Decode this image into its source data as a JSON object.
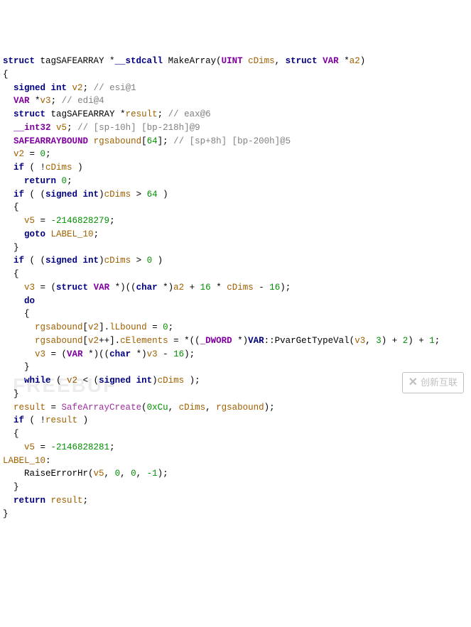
{
  "lines": [
    {
      "segments": [
        {
          "c": "ctype",
          "t": "struct"
        },
        {
          "c": "op",
          "t": " tagSAFEARRAY *"
        },
        {
          "c": "ctype",
          "t": "__stdcall"
        },
        {
          "c": "op",
          "t": " MakeArray("
        },
        {
          "c": "purple",
          "t": "UINT"
        },
        {
          "c": "op",
          "t": " "
        },
        {
          "c": "local",
          "t": "cDims"
        },
        {
          "c": "op",
          "t": ", "
        },
        {
          "c": "ctype",
          "t": "struct"
        },
        {
          "c": "op",
          "t": " "
        },
        {
          "c": "purple",
          "t": "VAR"
        },
        {
          "c": "op",
          "t": " *"
        },
        {
          "c": "local",
          "t": "a2"
        },
        {
          "c": "op",
          "t": ")"
        }
      ]
    },
    {
      "segments": [
        {
          "c": "op",
          "t": "{"
        }
      ]
    },
    {
      "segments": [
        {
          "c": "op",
          "t": "  "
        },
        {
          "c": "ctype",
          "t": "signed int"
        },
        {
          "c": "op",
          "t": " "
        },
        {
          "c": "local",
          "t": "v2"
        },
        {
          "c": "op",
          "t": "; "
        },
        {
          "c": "cmnt",
          "t": "// esi@1"
        }
      ]
    },
    {
      "segments": [
        {
          "c": "op",
          "t": "  "
        },
        {
          "c": "purple",
          "t": "VAR"
        },
        {
          "c": "op",
          "t": " *"
        },
        {
          "c": "local",
          "t": "v3"
        },
        {
          "c": "op",
          "t": "; "
        },
        {
          "c": "cmnt",
          "t": "// edi@4"
        }
      ]
    },
    {
      "segments": [
        {
          "c": "op",
          "t": "  "
        },
        {
          "c": "ctype",
          "t": "struct"
        },
        {
          "c": "op",
          "t": " tagSAFEARRAY *"
        },
        {
          "c": "local",
          "t": "result"
        },
        {
          "c": "op",
          "t": "; "
        },
        {
          "c": "cmnt",
          "t": "// eax@6"
        }
      ]
    },
    {
      "segments": [
        {
          "c": "op",
          "t": "  "
        },
        {
          "c": "purple",
          "t": "__int32"
        },
        {
          "c": "op",
          "t": " "
        },
        {
          "c": "local",
          "t": "v5"
        },
        {
          "c": "op",
          "t": "; "
        },
        {
          "c": "cmnt",
          "t": "// [sp-10h] [bp-218h]@9"
        }
      ]
    },
    {
      "segments": [
        {
          "c": "op",
          "t": "  "
        },
        {
          "c": "purple",
          "t": "SAFEARRAYBOUND"
        },
        {
          "c": "op",
          "t": " "
        },
        {
          "c": "local",
          "t": "rgsabound"
        },
        {
          "c": "op",
          "t": "["
        },
        {
          "c": "num",
          "t": "64"
        },
        {
          "c": "op",
          "t": "]; "
        },
        {
          "c": "cmnt",
          "t": "// [sp+8h] [bp-200h]@5"
        }
      ]
    },
    {
      "segments": [
        {
          "c": "op",
          "t": ""
        }
      ]
    },
    {
      "segments": [
        {
          "c": "op",
          "t": "  "
        },
        {
          "c": "local",
          "t": "v2"
        },
        {
          "c": "op",
          "t": " = "
        },
        {
          "c": "num",
          "t": "0"
        },
        {
          "c": "op",
          "t": ";"
        }
      ]
    },
    {
      "segments": [
        {
          "c": "op",
          "t": "  "
        },
        {
          "c": "ctype",
          "t": "if"
        },
        {
          "c": "op",
          "t": " ( !"
        },
        {
          "c": "local",
          "t": "cDims"
        },
        {
          "c": "op",
          "t": " )"
        }
      ]
    },
    {
      "segments": [
        {
          "c": "op",
          "t": "    "
        },
        {
          "c": "ctype",
          "t": "return"
        },
        {
          "c": "op",
          "t": " "
        },
        {
          "c": "num",
          "t": "0"
        },
        {
          "c": "op",
          "t": ";"
        }
      ]
    },
    {
      "segments": [
        {
          "c": "op",
          "t": "  "
        },
        {
          "c": "ctype",
          "t": "if"
        },
        {
          "c": "op",
          "t": " ( ("
        },
        {
          "c": "ctype",
          "t": "signed int"
        },
        {
          "c": "op",
          "t": ")"
        },
        {
          "c": "local",
          "t": "cDims"
        },
        {
          "c": "op",
          "t": " > "
        },
        {
          "c": "num",
          "t": "64"
        },
        {
          "c": "op",
          "t": " )"
        }
      ]
    },
    {
      "segments": [
        {
          "c": "op",
          "t": "  {"
        }
      ]
    },
    {
      "segments": [
        {
          "c": "op",
          "t": "    "
        },
        {
          "c": "local",
          "t": "v5"
        },
        {
          "c": "op",
          "t": " = "
        },
        {
          "c": "num",
          "t": "-2146828279"
        },
        {
          "c": "op",
          "t": ";"
        }
      ]
    },
    {
      "segments": [
        {
          "c": "op",
          "t": "    "
        },
        {
          "c": "ctype",
          "t": "goto"
        },
        {
          "c": "op",
          "t": " "
        },
        {
          "c": "local",
          "t": "LABEL_10"
        },
        {
          "c": "op",
          "t": ";"
        }
      ]
    },
    {
      "segments": [
        {
          "c": "op",
          "t": "  }"
        }
      ]
    },
    {
      "segments": [
        {
          "c": "op",
          "t": "  "
        },
        {
          "c": "ctype",
          "t": "if"
        },
        {
          "c": "op",
          "t": " ( ("
        },
        {
          "c": "ctype",
          "t": "signed int"
        },
        {
          "c": "op",
          "t": ")"
        },
        {
          "c": "local",
          "t": "cDims"
        },
        {
          "c": "op",
          "t": " > "
        },
        {
          "c": "num",
          "t": "0"
        },
        {
          "c": "op",
          "t": " )"
        }
      ]
    },
    {
      "segments": [
        {
          "c": "op",
          "t": "  {"
        }
      ]
    },
    {
      "segments": [
        {
          "c": "op",
          "t": "    "
        },
        {
          "c": "local",
          "t": "v3"
        },
        {
          "c": "op",
          "t": " = ("
        },
        {
          "c": "ctype",
          "t": "struct"
        },
        {
          "c": "op",
          "t": " "
        },
        {
          "c": "purple",
          "t": "VAR"
        },
        {
          "c": "op",
          "t": " *)(("
        },
        {
          "c": "ctype",
          "t": "char"
        },
        {
          "c": "op",
          "t": " *)"
        },
        {
          "c": "local",
          "t": "a2"
        },
        {
          "c": "op",
          "t": " + "
        },
        {
          "c": "num",
          "t": "16"
        },
        {
          "c": "op",
          "t": " * "
        },
        {
          "c": "local",
          "t": "cDims"
        },
        {
          "c": "op",
          "t": " - "
        },
        {
          "c": "num",
          "t": "16"
        },
        {
          "c": "op",
          "t": ");"
        }
      ]
    },
    {
      "segments": [
        {
          "c": "op",
          "t": "    "
        },
        {
          "c": "ctype",
          "t": "do"
        }
      ]
    },
    {
      "segments": [
        {
          "c": "op",
          "t": "    {"
        }
      ]
    },
    {
      "segments": [
        {
          "c": "op",
          "t": "      "
        },
        {
          "c": "local",
          "t": "rgsabound"
        },
        {
          "c": "op",
          "t": "["
        },
        {
          "c": "local",
          "t": "v2"
        },
        {
          "c": "op",
          "t": "]."
        },
        {
          "c": "local",
          "t": "lLbound"
        },
        {
          "c": "op",
          "t": " = "
        },
        {
          "c": "num",
          "t": "0"
        },
        {
          "c": "op",
          "t": ";"
        }
      ]
    },
    {
      "segments": [
        {
          "c": "op",
          "t": "      "
        },
        {
          "c": "local",
          "t": "rgsabound"
        },
        {
          "c": "op",
          "t": "["
        },
        {
          "c": "local",
          "t": "v2"
        },
        {
          "c": "op",
          "t": "++]."
        },
        {
          "c": "local",
          "t": "cElements"
        },
        {
          "c": "op",
          "t": " = *(("
        },
        {
          "c": "purple",
          "t": "_DWORD"
        },
        {
          "c": "op",
          "t": " *)"
        },
        {
          "c": "ctype",
          "t": "VAR"
        },
        {
          "c": "op",
          "t": "::PvarGetTypeVal("
        },
        {
          "c": "local",
          "t": "v3"
        },
        {
          "c": "op",
          "t": ", "
        },
        {
          "c": "num",
          "t": "3"
        },
        {
          "c": "op",
          "t": ") + "
        },
        {
          "c": "num",
          "t": "2"
        },
        {
          "c": "op",
          "t": ") + "
        },
        {
          "c": "num",
          "t": "1"
        },
        {
          "c": "op",
          "t": ";"
        }
      ]
    },
    {
      "segments": [
        {
          "c": "op",
          "t": "      "
        },
        {
          "c": "local",
          "t": "v3"
        },
        {
          "c": "op",
          "t": " = ("
        },
        {
          "c": "purple",
          "t": "VAR"
        },
        {
          "c": "op",
          "t": " *)(("
        },
        {
          "c": "ctype",
          "t": "char"
        },
        {
          "c": "op",
          "t": " *)"
        },
        {
          "c": "local",
          "t": "v3"
        },
        {
          "c": "op",
          "t": " - "
        },
        {
          "c": "num",
          "t": "16"
        },
        {
          "c": "op",
          "t": ");"
        }
      ]
    },
    {
      "segments": [
        {
          "c": "op",
          "t": "    }"
        }
      ]
    },
    {
      "segments": [
        {
          "c": "op",
          "t": "    "
        },
        {
          "c": "ctype",
          "t": "while"
        },
        {
          "c": "op",
          "t": " ( "
        },
        {
          "c": "local",
          "t": "v2"
        },
        {
          "c": "op",
          "t": " < ("
        },
        {
          "c": "ctype",
          "t": "signed int"
        },
        {
          "c": "op",
          "t": ")"
        },
        {
          "c": "local",
          "t": "cDims"
        },
        {
          "c": "op",
          "t": " );"
        }
      ]
    },
    {
      "segments": [
        {
          "c": "op",
          "t": "  }"
        }
      ]
    },
    {
      "segments": [
        {
          "c": "op",
          "t": "  "
        },
        {
          "c": "local",
          "t": "result"
        },
        {
          "c": "op",
          "t": " = "
        },
        {
          "c": "func",
          "t": "SafeArrayCreate"
        },
        {
          "c": "op",
          "t": "("
        },
        {
          "c": "num",
          "t": "0xCu"
        },
        {
          "c": "op",
          "t": ", "
        },
        {
          "c": "local",
          "t": "cDims"
        },
        {
          "c": "op",
          "t": ", "
        },
        {
          "c": "local",
          "t": "rgsabound"
        },
        {
          "c": "op",
          "t": ");"
        }
      ]
    },
    {
      "segments": [
        {
          "c": "op",
          "t": "  "
        },
        {
          "c": "ctype",
          "t": "if"
        },
        {
          "c": "op",
          "t": " ( !"
        },
        {
          "c": "local",
          "t": "result"
        },
        {
          "c": "op",
          "t": " )"
        }
      ]
    },
    {
      "segments": [
        {
          "c": "op",
          "t": "  {"
        }
      ]
    },
    {
      "segments": [
        {
          "c": "op",
          "t": "    "
        },
        {
          "c": "local",
          "t": "v5"
        },
        {
          "c": "op",
          "t": " = "
        },
        {
          "c": "num",
          "t": "-2146828281"
        },
        {
          "c": "op",
          "t": ";"
        }
      ]
    },
    {
      "segments": [
        {
          "c": "local",
          "t": "LABEL_10"
        },
        {
          "c": "op",
          "t": ":"
        }
      ]
    },
    {
      "segments": [
        {
          "c": "op",
          "t": "    RaiseErrorHr("
        },
        {
          "c": "local",
          "t": "v5"
        },
        {
          "c": "op",
          "t": ", "
        },
        {
          "c": "num",
          "t": "0"
        },
        {
          "c": "op",
          "t": ", "
        },
        {
          "c": "num",
          "t": "0"
        },
        {
          "c": "op",
          "t": ", "
        },
        {
          "c": "num",
          "t": "-1"
        },
        {
          "c": "op",
          "t": ");"
        }
      ]
    },
    {
      "segments": [
        {
          "c": "op",
          "t": "  }"
        }
      ]
    },
    {
      "segments": [
        {
          "c": "op",
          "t": "  "
        },
        {
          "c": "ctype",
          "t": "return"
        },
        {
          "c": "op",
          "t": " "
        },
        {
          "c": "local",
          "t": "result"
        },
        {
          "c": "op",
          "t": ";"
        }
      ]
    },
    {
      "segments": [
        {
          "c": "op",
          "t": "}"
        }
      ]
    }
  ],
  "watermark1": "FREEBUF",
  "watermark2_icon": "✕",
  "watermark2_text": "创新互联"
}
